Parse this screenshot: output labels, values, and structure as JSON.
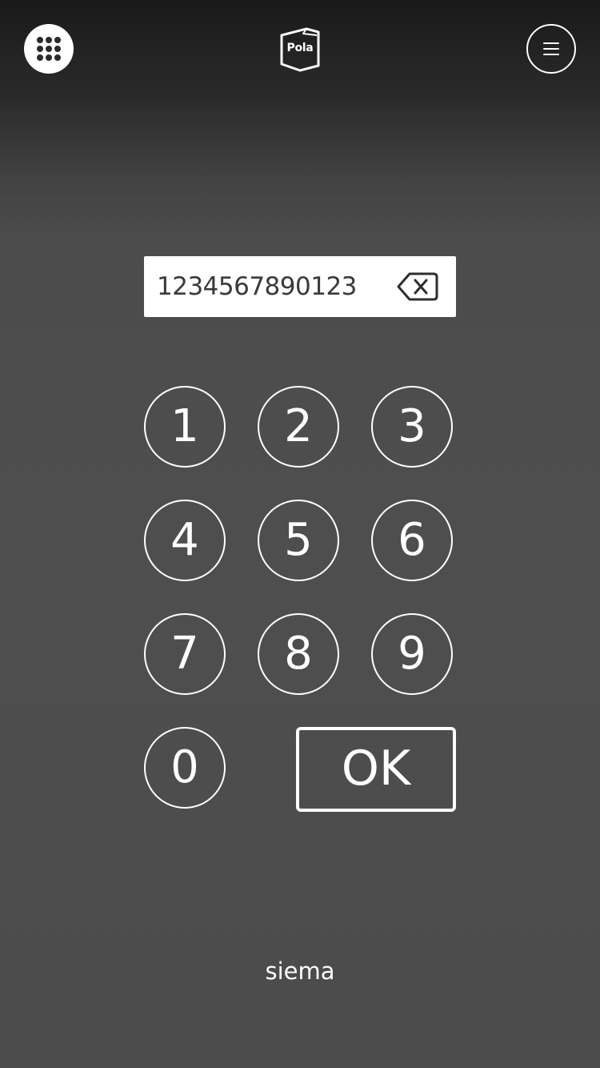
{
  "header": {
    "logo_text": "Pola",
    "left_button_icon": "keypad-grid-icon",
    "right_button_icon": "hamburger-menu-icon"
  },
  "barcode": {
    "value": "1234567890123",
    "clear_icon": "backspace-icon"
  },
  "keypad": {
    "keys": [
      "1",
      "2",
      "3",
      "4",
      "5",
      "6",
      "7",
      "8",
      "9",
      "0"
    ],
    "ok_label": "OK"
  },
  "footer": {
    "text": "siema"
  },
  "colors": {
    "foreground": "#ffffff",
    "background_top": "#1a1a1a",
    "background_main": "#4e4e4e",
    "field_text": "#3a3a3a"
  }
}
